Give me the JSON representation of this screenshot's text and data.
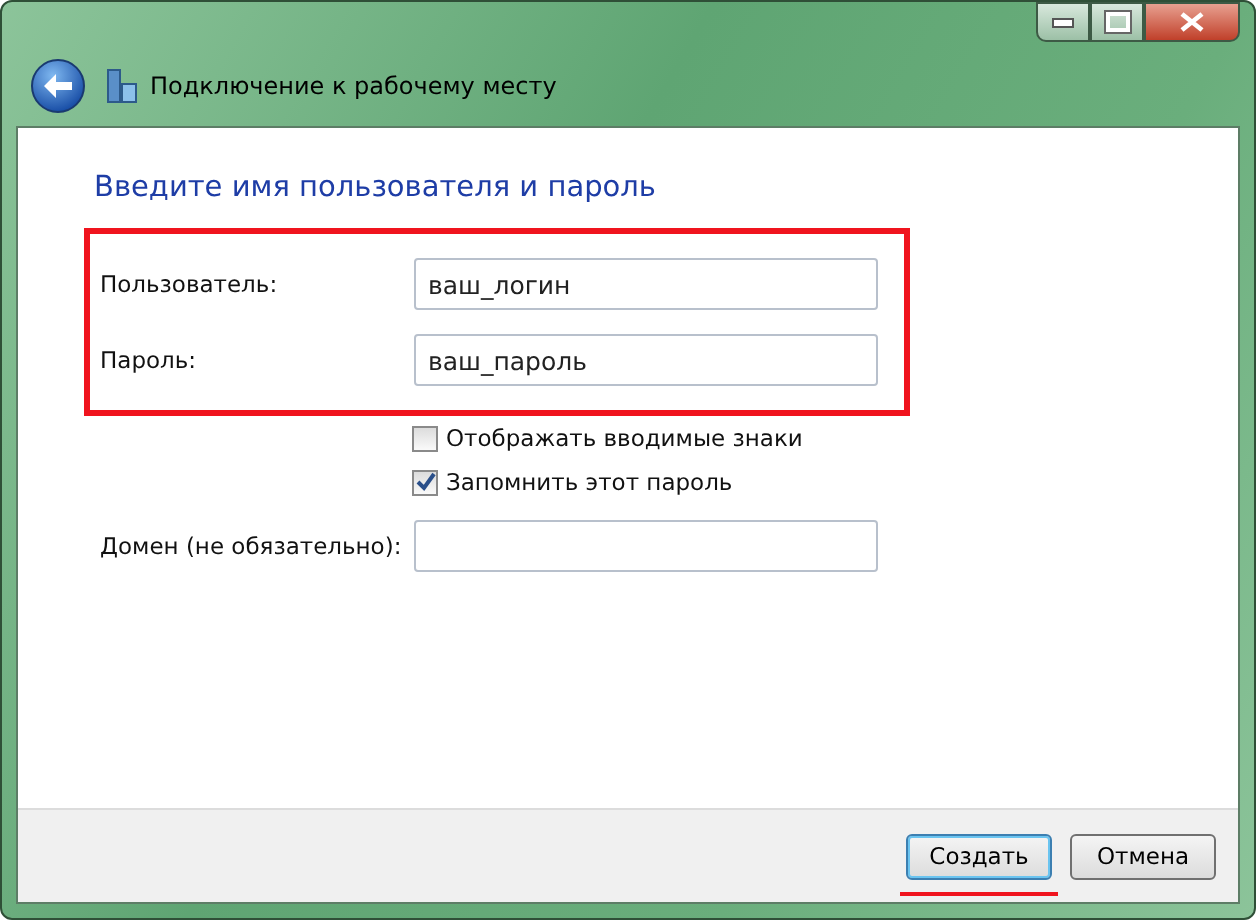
{
  "window": {
    "title": "Подключение к рабочему месту"
  },
  "heading": "Введите имя пользователя и пароль",
  "credentials": {
    "highlighted": true,
    "fields": [
      {
        "label": "Пользователь:",
        "value": "ваш_логин"
      },
      {
        "label": "Пароль:",
        "value": "ваш_пароль"
      }
    ]
  },
  "options": [
    {
      "label": "Отображать вводимые знаки",
      "checked": false
    },
    {
      "label": "Запомнить этот пароль",
      "checked": true
    }
  ],
  "domain": {
    "label": "Домен (не обязательно):"
  },
  "buttons": [
    {
      "label": "Создать",
      "default": true,
      "underlined": true
    },
    {
      "label": "Отмена",
      "default": false,
      "underlined": false
    }
  ]
}
